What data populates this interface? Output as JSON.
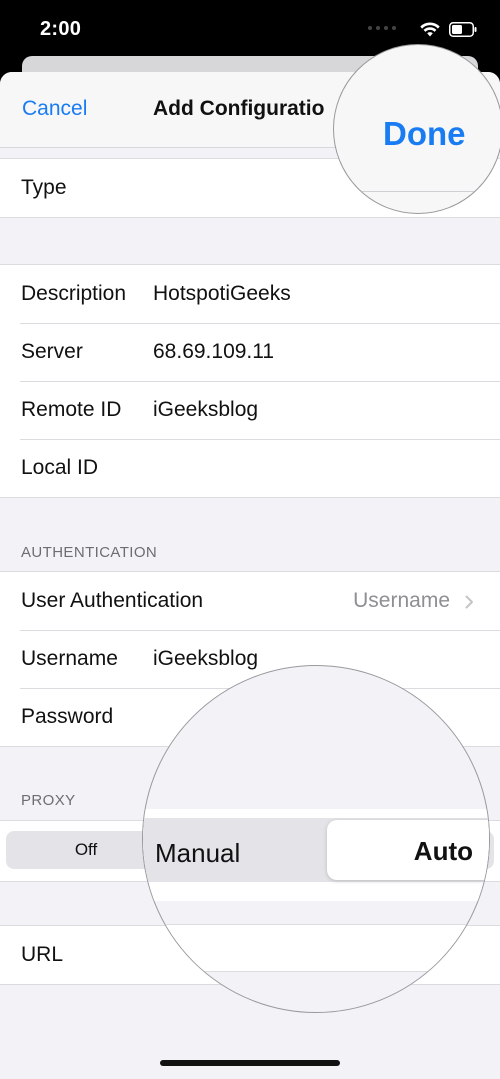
{
  "status_bar": {
    "time": "2:00",
    "wifi_icon": "wifi-icon",
    "battery_icon": "battery-icon"
  },
  "nav": {
    "cancel": "Cancel",
    "title": "Add Configuratio",
    "done": "Done"
  },
  "type_row": {
    "label": "Type"
  },
  "general_rows": [
    {
      "label": "Description",
      "value": "HotspotiGeeks"
    },
    {
      "label": "Server",
      "value": "68.69.109.11"
    },
    {
      "label": "Remote ID",
      "value": "iGeeksblog"
    },
    {
      "label": "Local ID",
      "value": ""
    }
  ],
  "authentication": {
    "header": "AUTHENTICATION",
    "user_authentication": {
      "label": "User Authentication",
      "value": "Username"
    },
    "username": {
      "label": "Username",
      "value": "iGeeksblog"
    },
    "password": {
      "label": "Password",
      "value": ""
    }
  },
  "proxy": {
    "header": "PROXY",
    "options": [
      "Off",
      "Manual",
      "Auto"
    ],
    "selected": "Auto",
    "url_label": "URL"
  },
  "colors": {
    "accent": "#1a7cf2",
    "background": "#f2f2f7"
  }
}
